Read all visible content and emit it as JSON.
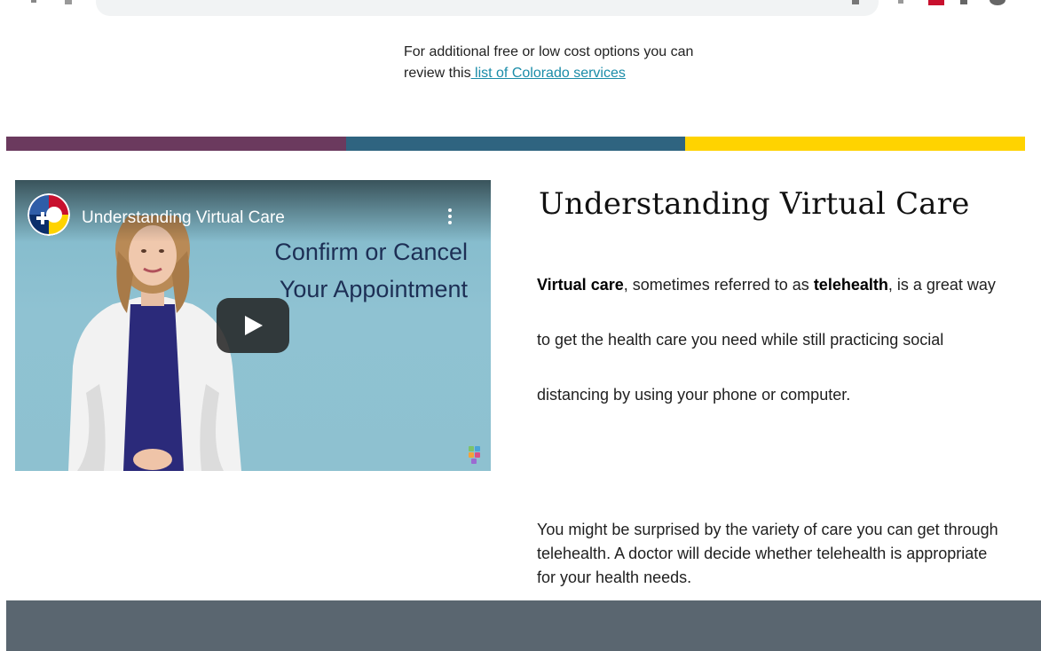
{
  "intro": {
    "line1": "For additional free or low cost options you can",
    "line2_prefix": "review this",
    "link_text": " list of Colorado services"
  },
  "band_colors": [
    "#6b3a5e",
    "#2f6480",
    "#ffd300"
  ],
  "video": {
    "title": "Understanding Virtual Care",
    "overlay_line1": "Confirm or Cancel",
    "overlay_line2": "Your Appointment",
    "play_icon": "play-icon",
    "menu_icon": "kebab-menu-icon"
  },
  "article": {
    "heading": "Understanding Virtual Care",
    "p1_bold1": "Virtual care",
    "p1_text1": ", sometimes referred to as ",
    "p1_bold2": "telehealth",
    "p1_text2": ", is a great way to get the health care you need while still practicing social distancing by using your phone or computer.",
    "p2": "You might be surprised by the variety of care you can get through telehealth. A doctor will decide whether telehealth is appropriate for your health needs."
  },
  "colors": {
    "link": "#1a8ca8",
    "footer": "#5a6670"
  }
}
